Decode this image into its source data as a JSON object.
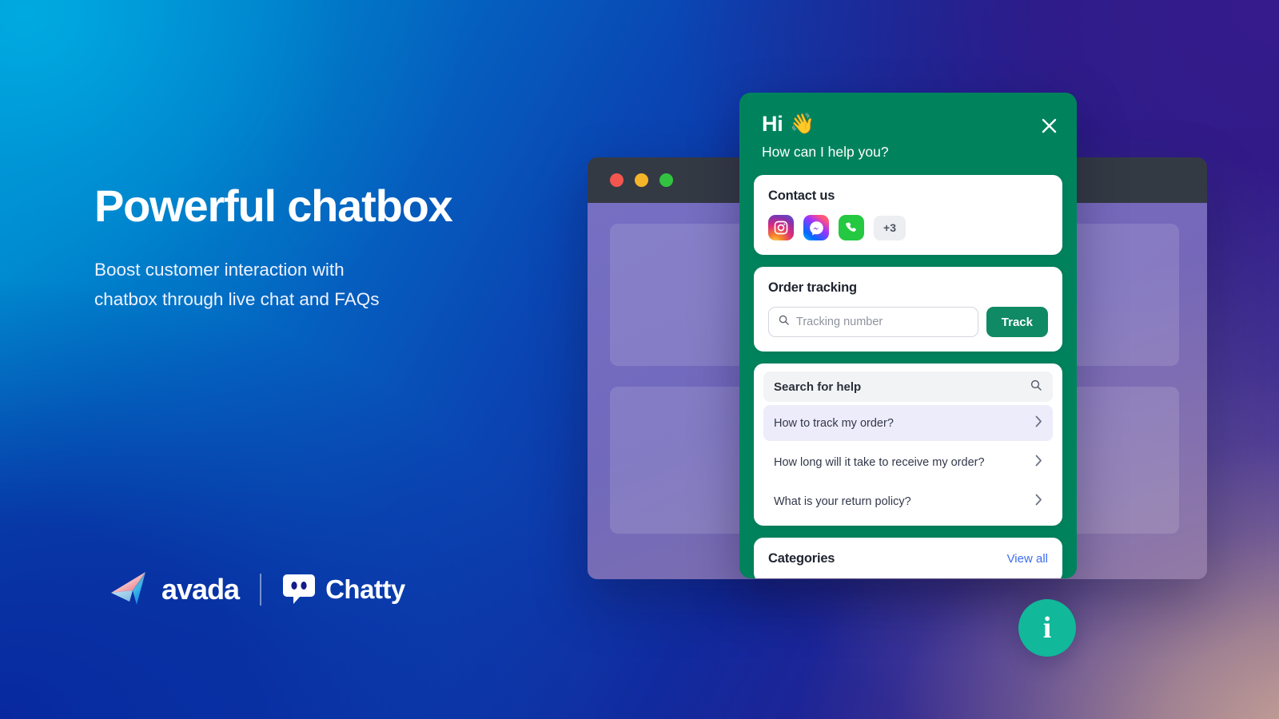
{
  "hero": {
    "title": "Powerful chatbox",
    "subtitle_line1": "Boost customer interaction with",
    "subtitle_line2": "chatbox through live chat and FAQs"
  },
  "brands": {
    "avada_name": "avada",
    "avada_icon": "paper-plane-icon",
    "chatty_name": "Chatty",
    "chatty_icon": "chat-bubble-icon"
  },
  "browser": {
    "dots": [
      "red",
      "yellow",
      "green"
    ]
  },
  "widget": {
    "header": {
      "greeting": "Hi",
      "wave_emoji": "👋",
      "subtitle": "How can I help you?",
      "close_icon": "close-icon",
      "background_color": "#00835d"
    },
    "contact": {
      "title": "Contact us",
      "channels": [
        {
          "name": "instagram",
          "label": "Instagram"
        },
        {
          "name": "messenger",
          "label": "Messenger"
        },
        {
          "name": "whatsapp",
          "label": "WhatsApp"
        }
      ],
      "more_label": "+3"
    },
    "order_tracking": {
      "title": "Order tracking",
      "input_value": "",
      "input_placeholder": "Tracking number",
      "search_icon": "search-icon",
      "button_label": "Track",
      "button_color": "#108a64"
    },
    "help": {
      "search_label": "Search for help",
      "search_icon": "search-icon",
      "items": [
        {
          "label": "How to track my order?",
          "active": true
        },
        {
          "label": "How long will it take to receive my order?",
          "active": false
        },
        {
          "label": "What is your return policy?",
          "active": false
        }
      ]
    },
    "categories": {
      "title": "Categories",
      "view_all_label": "View all",
      "link_color": "#3d6df0"
    }
  },
  "launcher": {
    "icon": "info-icon",
    "glyph": "i",
    "color": "#11b89a"
  }
}
